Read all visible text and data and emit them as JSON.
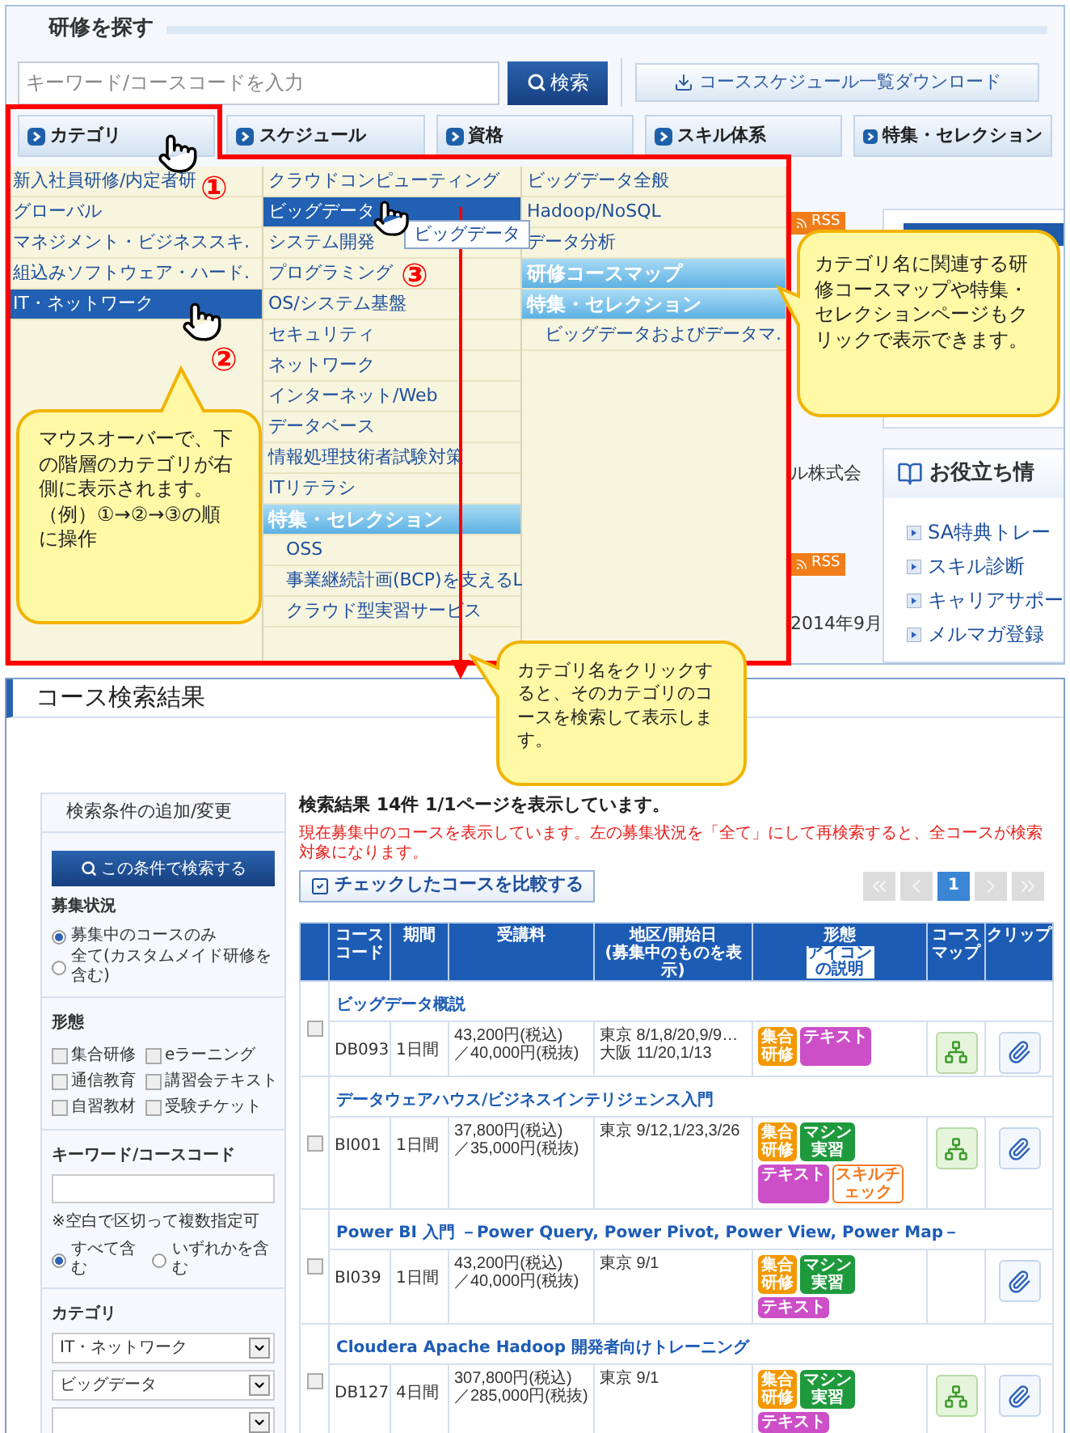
{
  "search_panel": {
    "title": "研修を探す",
    "search": {
      "placeholder": "キーワード/コースコードを入力"
    },
    "search_button": "検索",
    "download_button": "コーススケジュール一覧ダウンロード",
    "tabs": [
      {
        "label": "カテゴリ"
      },
      {
        "label": "スケジュール"
      },
      {
        "label": "資格"
      },
      {
        "label": "スキル体系"
      },
      {
        "label": "特集・セレクション"
      }
    ]
  },
  "menu": {
    "columns": [
      {
        "items": [
          {
            "label": "新入社員研修/内定者研",
            "kind": "link",
            "selected": false
          },
          {
            "label": "グローバル",
            "kind": "link",
            "selected": false
          },
          {
            "label": "マネジメント・ビジネススキ.",
            "kind": "link",
            "selected": false
          },
          {
            "label": "組込みソフトウェア・ハード.",
            "kind": "link",
            "selected": false
          },
          {
            "label": "IT・ネットワーク",
            "kind": "link",
            "selected": true
          }
        ]
      },
      {
        "items": [
          {
            "label": "クラウドコンピューティング",
            "kind": "link",
            "selected": false
          },
          {
            "label": "ビッグデータ",
            "kind": "link",
            "selected": true
          },
          {
            "label": "システム開発",
            "kind": "link",
            "selected": false
          },
          {
            "label": "プログラミング",
            "kind": "link",
            "selected": false
          },
          {
            "label": "OS/システム基盤",
            "kind": "link",
            "selected": false
          },
          {
            "label": "セキュリティ",
            "kind": "link",
            "selected": false
          },
          {
            "label": "ネットワーク",
            "kind": "link",
            "selected": false
          },
          {
            "label": "インターネット/Web",
            "kind": "link",
            "selected": false
          },
          {
            "label": "データベース",
            "kind": "link",
            "selected": false
          },
          {
            "label": "情報処理技術者試験対策",
            "kind": "link",
            "selected": false
          },
          {
            "label": "ITリテラシ",
            "kind": "link",
            "selected": false
          },
          {
            "label": "特集・セレクション",
            "kind": "header",
            "selected": false
          },
          {
            "label": "OSS",
            "kind": "subitem",
            "selected": false
          },
          {
            "label": "事業継続計画(BCP)を支えるL",
            "kind": "subitem",
            "selected": false
          },
          {
            "label": "クラウド型実習サービス",
            "kind": "subitem",
            "selected": false
          }
        ]
      },
      {
        "items": [
          {
            "label": "ビッグデータ全般",
            "kind": "link",
            "selected": false
          },
          {
            "label": "Hadoop/NoSQL",
            "kind": "link",
            "selected": false
          },
          {
            "label": "データ分析",
            "kind": "link",
            "selected": false
          },
          {
            "label": "研修コースマップ",
            "kind": "header",
            "selected": false
          },
          {
            "label": "特集・セレクション",
            "kind": "header",
            "selected": false
          },
          {
            "label": "ビッグデータおよびデータマ.",
            "kind": "subitem",
            "selected": false
          }
        ]
      }
    ],
    "tooltip": "ビッグデータ"
  },
  "background": {
    "rss_badges": [
      "RSS",
      "RSS"
    ],
    "company_text": "ル株式会",
    "date_text": "2014年9月",
    "info_box": {
      "title": "お役立ち情",
      "links": [
        "SA特典トレー",
        "スキル診断",
        "キャリアサポー",
        "メルマガ登録"
      ]
    }
  },
  "annotations": {
    "markers": [
      "①",
      "②",
      "③"
    ],
    "callouts": [
      "マウスオーバーで、下の階層のカテゴリが右側に表示されます。（例）①→②→③の順に操作",
      "カテゴリ名に関連する研修コースマップや特集・セレクションページもクリックで表示できます。",
      "カテゴリ名をクリックすると、そのカテゴリのコースを検索して表示します。"
    ]
  },
  "results": {
    "title": "コース検索結果",
    "sidebar": {
      "title": "検索条件の追加/変更",
      "search_button": "この条件で検索する",
      "status": {
        "label": "募集状況",
        "options": [
          {
            "label": "募集中のコースのみ",
            "selected": true
          },
          {
            "label": "全て(カスタムメイド研修を含む)",
            "selected": false
          }
        ]
      },
      "formats": {
        "label": "形態",
        "options": [
          {
            "label": "集合研修",
            "checked": false
          },
          {
            "label": "eラーニング",
            "checked": false
          },
          {
            "label": "通信教育",
            "checked": false
          },
          {
            "label": "講習会テキスト",
            "checked": false
          },
          {
            "label": "自習教材",
            "checked": false
          },
          {
            "label": "受験チケット",
            "checked": false
          }
        ]
      },
      "keyword": {
        "label": "キーワード/コースコード",
        "note": "※空白で区切って複数指定可",
        "options": [
          {
            "label": "すべて含む",
            "selected": true
          },
          {
            "label": "いずれかを含む",
            "selected": false
          }
        ]
      },
      "category": {
        "label": "カテゴリ",
        "selects": [
          {
            "value": "IT・ネットワーク"
          },
          {
            "value": "ビッグデータ"
          }
        ]
      }
    },
    "summary": "検索結果 14件 1/1ページを表示しています。",
    "notice": "現在募集中のコースを表示しています。左の募集状況を「全て」にして再検索すると、全コースが検索対象になります。",
    "compare_button": "チェックしたコースを比較する",
    "pagination": [
      {
        "kind": "first",
        "disabled": true
      },
      {
        "kind": "prev",
        "disabled": true
      },
      {
        "kind": "page",
        "label": "1",
        "selected": true
      },
      {
        "kind": "next",
        "disabled": true
      },
      {
        "kind": "last",
        "disabled": true
      }
    ],
    "columns": [
      {
        "label": "コースコード"
      },
      {
        "label": "期間"
      },
      {
        "label": "受講料"
      },
      {
        "label": "地区/開始日\n(募集中のものを表示)"
      },
      {
        "label": "形態",
        "note": "アイコンの説明"
      },
      {
        "label": "コースマップ"
      },
      {
        "label": "クリップ"
      }
    ],
    "rows": [
      {
        "title": "ビッグデータ概説",
        "checked": false,
        "code": "DB093",
        "period": "1日間",
        "fee": "43,200円(税込)\n／40,000円(税抜)",
        "area": "東京 8/1,8/20,9/9…\n大阪 11/20,1/13",
        "map": true,
        "badges": [
          {
            "label": "集合研修",
            "kind": "filled",
            "color": "#f39800"
          },
          {
            "label": "テキスト",
            "kind": "filled",
            "color": "#cc4fc8"
          }
        ]
      },
      {
        "title": "データウェアハウス/ビジネスインテリジェンス入門",
        "checked": false,
        "code": "BI001",
        "period": "1日間",
        "fee": "37,800円(税込)\n／35,000円(税抜)",
        "area": "東京 9/12,1/23,3/26",
        "map": true,
        "badges": [
          {
            "label": "集合研修",
            "kind": "filled",
            "color": "#f39800"
          },
          {
            "label": "マシン実習",
            "kind": "filled",
            "color": "#1e9a3c"
          },
          {
            "label": "テキスト",
            "kind": "filled",
            "color": "#cc4fc8"
          },
          {
            "label": "スキルチェック",
            "kind": "outline",
            "color": "#f37a1f"
          }
        ]
      },
      {
        "title": "Power BI 入門 －Power Query, Power Pivot, Power View, Power Map－",
        "checked": false,
        "code": "BI039",
        "period": "1日間",
        "fee": "43,200円(税込)\n／40,000円(税抜)",
        "area": "東京 9/1",
        "map": false,
        "badges": [
          {
            "label": "集合研修",
            "kind": "filled",
            "color": "#f39800"
          },
          {
            "label": "マシン実習",
            "kind": "filled",
            "color": "#1e9a3c"
          },
          {
            "label": "テキスト",
            "kind": "filled",
            "color": "#cc4fc8"
          }
        ]
      },
      {
        "title": "Cloudera Apache Hadoop 開発者向けトレーニング",
        "checked": false,
        "code": "DB127",
        "period": "4日間",
        "fee": "307,800円(税込)\n／285,000円(税抜)",
        "area": "東京 9/1",
        "map": true,
        "badges": [
          {
            "label": "集合研修",
            "kind": "filled",
            "color": "#f39800"
          },
          {
            "label": "マシン実習",
            "kind": "filled",
            "color": "#1e9a3c"
          },
          {
            "label": "テキスト",
            "kind": "filled",
            "color": "#cc4fc8"
          }
        ]
      }
    ]
  }
}
